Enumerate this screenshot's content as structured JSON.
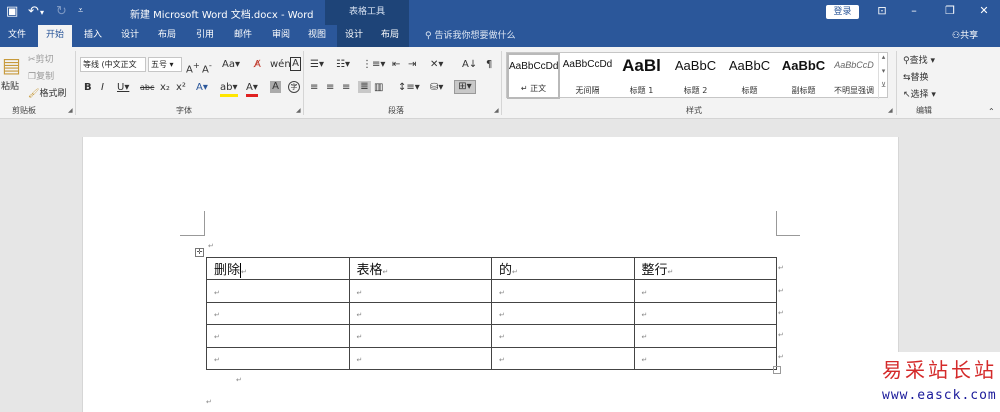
{
  "window": {
    "title": "新建 Microsoft Word 文档.docx - Word",
    "context_tools_label": "表格工具",
    "login_label": "登录"
  },
  "tabs": [
    "文件",
    "开始",
    "插入",
    "设计",
    "布局",
    "引用",
    "邮件",
    "审阅",
    "视图"
  ],
  "tool_tabs": [
    "设计",
    "布局"
  ],
  "tellme": "告诉我你想要做什么",
  "share_label": "共享",
  "ribbon": {
    "clipboard": {
      "paste": "粘贴",
      "cut": "剪切",
      "copy": "复制",
      "format_painter": "格式刷",
      "label": "剪贴板"
    },
    "font": {
      "name": "等线 (中文正文)",
      "name_shown": "等线 (中文正文",
      "size": "五号",
      "label": "字体"
    },
    "paragraph": {
      "label": "段落"
    },
    "styles": {
      "label": "样式",
      "items": [
        {
          "sample": "AaBbCcDd",
          "name": "正文"
        },
        {
          "sample": "AaBbCcDd",
          "name": "无间隔"
        },
        {
          "sample": "AaBl",
          "name": "标题 1"
        },
        {
          "sample": "AaBbC",
          "name": "标题 2"
        },
        {
          "sample": "AaBbC",
          "name": "标题"
        },
        {
          "sample": "AaBbC",
          "name": "副标题"
        },
        {
          "sample": "AaBbCcD",
          "name": "不明显强调"
        }
      ]
    },
    "editing": {
      "find": "查找",
      "replace": "替换",
      "select": "选择",
      "label": "编辑"
    }
  },
  "document": {
    "table": {
      "header_row": [
        "删除",
        "表格",
        "的",
        "整行"
      ],
      "empty_rows": 4
    }
  },
  "watermark": {
    "title": "易采站长站",
    "url": "www.easck.com"
  },
  "colors": {
    "accent": "#2b579a",
    "tool_band": "#1e4478",
    "ribbon_bg": "#f3f3f3",
    "page_bg": "#e6e6e6"
  }
}
